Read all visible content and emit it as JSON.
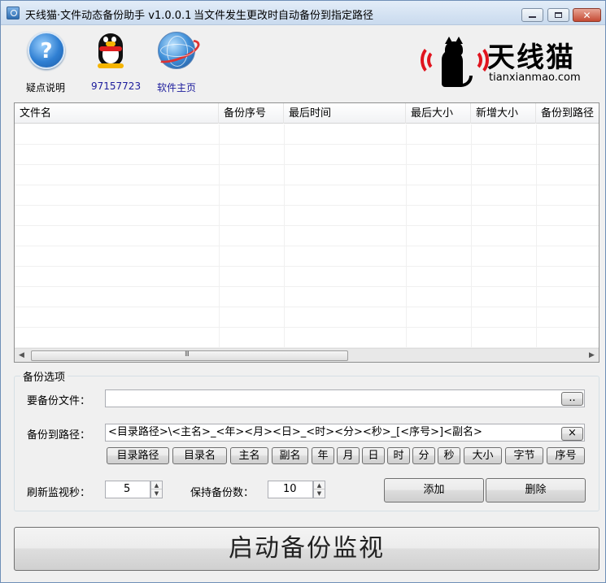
{
  "window": {
    "title": "天线猫·文件动态备份助手 v1.0.0.1",
    "subtitle": "当文件发生更改时自动备份到指定路径",
    "controls": {
      "minimize": "minimize",
      "maximize": "maximize",
      "close": "close"
    }
  },
  "toolbar": {
    "help_label": "疑点说明",
    "qq_label": "97157723",
    "home_label": "软件主页",
    "qq_label_color": "#1c1c9c",
    "home_label_color": "#1c1c9c"
  },
  "logo": {
    "cn": "天线猫",
    "en": "tianxianmao.com",
    "accent": "#e0141e"
  },
  "list": {
    "columns": [
      "文件名",
      "备份序号",
      "最后时间",
      "最后大小",
      "新增大小",
      "备份到路径"
    ],
    "rows": [],
    "scroll_grip": "III"
  },
  "options": {
    "group_title": "备份选项",
    "file_label": "要备份文件：",
    "file_value": "",
    "browse_label": "..",
    "path_label": "备份到路径：",
    "path_value": "<目录路径>\\<主名>_<年><月><日>_<时><分><秒>_[<序号>]<副名>",
    "clear_label": "×",
    "tokens": [
      "目录路径",
      "目录名",
      "主名",
      "副名",
      "年",
      "月",
      "日",
      "时",
      "分",
      "秒",
      "大小",
      "字节",
      "序号"
    ],
    "refresh_label": "刷新监视秒：",
    "refresh_value": "5",
    "keep_label": "保持备份数：",
    "keep_value": "10",
    "add_label": "添加",
    "delete_label": "删除"
  },
  "start_button": "启动备份监视"
}
